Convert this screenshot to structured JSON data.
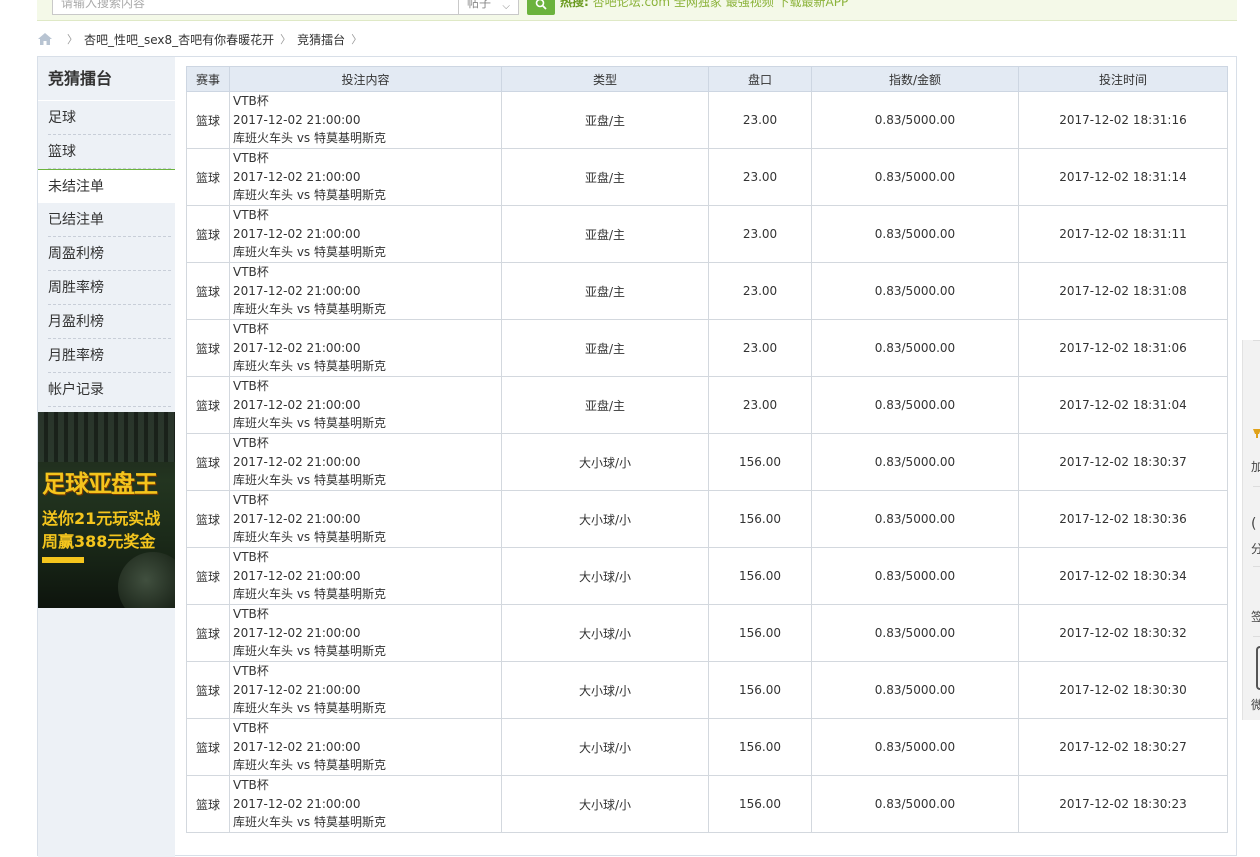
{
  "topbar": {
    "search_placeholder": "请输入搜索内容",
    "search_scope": "帖子",
    "notice_label": "热搜:",
    "notice_text": "杏吧论坛.com 全网独家 最强视频 下载最新APP"
  },
  "breadcrumb": {
    "items": [
      "杏吧_性吧_sex8_杏吧有你春暖花开",
      "竞猜擂台"
    ]
  },
  "sidebar": {
    "title": "竞猜擂台",
    "items": [
      {
        "label": "足球"
      },
      {
        "label": "篮球"
      },
      {
        "label": "未结注单"
      },
      {
        "label": "已结注单"
      },
      {
        "label": "周盈利榜"
      },
      {
        "label": "周胜率榜"
      },
      {
        "label": "月盈利榜"
      },
      {
        "label": "月胜率榜"
      },
      {
        "label": "帐户记录"
      }
    ],
    "active_index": 2,
    "banner": {
      "line1": "足球亚盘王",
      "line2": "送你21元玩实战",
      "line3": "周赢388元奖金"
    }
  },
  "table": {
    "headers": [
      "赛事",
      "投注内容",
      "类型",
      "盘口",
      "指数/金额",
      "投注时间"
    ],
    "rows": [
      {
        "sport": "篮球",
        "league": "VTB杯",
        "match_time": "2017-12-02 21:00:00",
        "teams": "库班火车头 vs 特莫基明斯克",
        "type": "亚盘/主",
        "handicap": "23.00",
        "odds_amount": "0.83/5000.00",
        "bet_time": "2017-12-02 18:31:16"
      },
      {
        "sport": "篮球",
        "league": "VTB杯",
        "match_time": "2017-12-02 21:00:00",
        "teams": "库班火车头 vs 特莫基明斯克",
        "type": "亚盘/主",
        "handicap": "23.00",
        "odds_amount": "0.83/5000.00",
        "bet_time": "2017-12-02 18:31:14"
      },
      {
        "sport": "篮球",
        "league": "VTB杯",
        "match_time": "2017-12-02 21:00:00",
        "teams": "库班火车头 vs 特莫基明斯克",
        "type": "亚盘/主",
        "handicap": "23.00",
        "odds_amount": "0.83/5000.00",
        "bet_time": "2017-12-02 18:31:11"
      },
      {
        "sport": "篮球",
        "league": "VTB杯",
        "match_time": "2017-12-02 21:00:00",
        "teams": "库班火车头 vs 特莫基明斯克",
        "type": "亚盘/主",
        "handicap": "23.00",
        "odds_amount": "0.83/5000.00",
        "bet_time": "2017-12-02 18:31:08"
      },
      {
        "sport": "篮球",
        "league": "VTB杯",
        "match_time": "2017-12-02 21:00:00",
        "teams": "库班火车头 vs 特莫基明斯克",
        "type": "亚盘/主",
        "handicap": "23.00",
        "odds_amount": "0.83/5000.00",
        "bet_time": "2017-12-02 18:31:06"
      },
      {
        "sport": "篮球",
        "league": "VTB杯",
        "match_time": "2017-12-02 21:00:00",
        "teams": "库班火车头 vs 特莫基明斯克",
        "type": "亚盘/主",
        "handicap": "23.00",
        "odds_amount": "0.83/5000.00",
        "bet_time": "2017-12-02 18:31:04"
      },
      {
        "sport": "篮球",
        "league": "VTB杯",
        "match_time": "2017-12-02 21:00:00",
        "teams": "库班火车头 vs 特莫基明斯克",
        "type": "大小球/小",
        "handicap": "156.00",
        "odds_amount": "0.83/5000.00",
        "bet_time": "2017-12-02 18:30:37"
      },
      {
        "sport": "篮球",
        "league": "VTB杯",
        "match_time": "2017-12-02 21:00:00",
        "teams": "库班火车头 vs 特莫基明斯克",
        "type": "大小球/小",
        "handicap": "156.00",
        "odds_amount": "0.83/5000.00",
        "bet_time": "2017-12-02 18:30:36"
      },
      {
        "sport": "篮球",
        "league": "VTB杯",
        "match_time": "2017-12-02 21:00:00",
        "teams": "库班火车头 vs 特莫基明斯克",
        "type": "大小球/小",
        "handicap": "156.00",
        "odds_amount": "0.83/5000.00",
        "bet_time": "2017-12-02 18:30:34"
      },
      {
        "sport": "篮球",
        "league": "VTB杯",
        "match_time": "2017-12-02 21:00:00",
        "teams": "库班火车头 vs 特莫基明斯克",
        "type": "大小球/小",
        "handicap": "156.00",
        "odds_amount": "0.83/5000.00",
        "bet_time": "2017-12-02 18:30:32"
      },
      {
        "sport": "篮球",
        "league": "VTB杯",
        "match_time": "2017-12-02 21:00:00",
        "teams": "库班火车头 vs 特莫基明斯克",
        "type": "大小球/小",
        "handicap": "156.00",
        "odds_amount": "0.83/5000.00",
        "bet_time": "2017-12-02 18:30:30"
      },
      {
        "sport": "篮球",
        "league": "VTB杯",
        "match_time": "2017-12-02 21:00:00",
        "teams": "库班火车头 vs 特莫基明斯克",
        "type": "大小球/小",
        "handicap": "156.00",
        "odds_amount": "0.83/5000.00",
        "bet_time": "2017-12-02 18:30:27"
      },
      {
        "sport": "篮球",
        "league": "VTB杯",
        "match_time": "2017-12-02 21:00:00",
        "teams": "库班火车头 vs 特莫基明斯克",
        "type": "大小球/小",
        "handicap": "156.00",
        "odds_amount": "0.83/5000.00",
        "bet_time": "2017-12-02 18:30:23"
      }
    ]
  },
  "float_side": {
    "items": [
      "加",
      "分",
      "签",
      "微"
    ]
  },
  "colors": {
    "accent": "#6cb33e",
    "sidebar_bg": "#edf1f6",
    "header_bg": "#e3eaf3",
    "notice": "#8bb33a"
  }
}
